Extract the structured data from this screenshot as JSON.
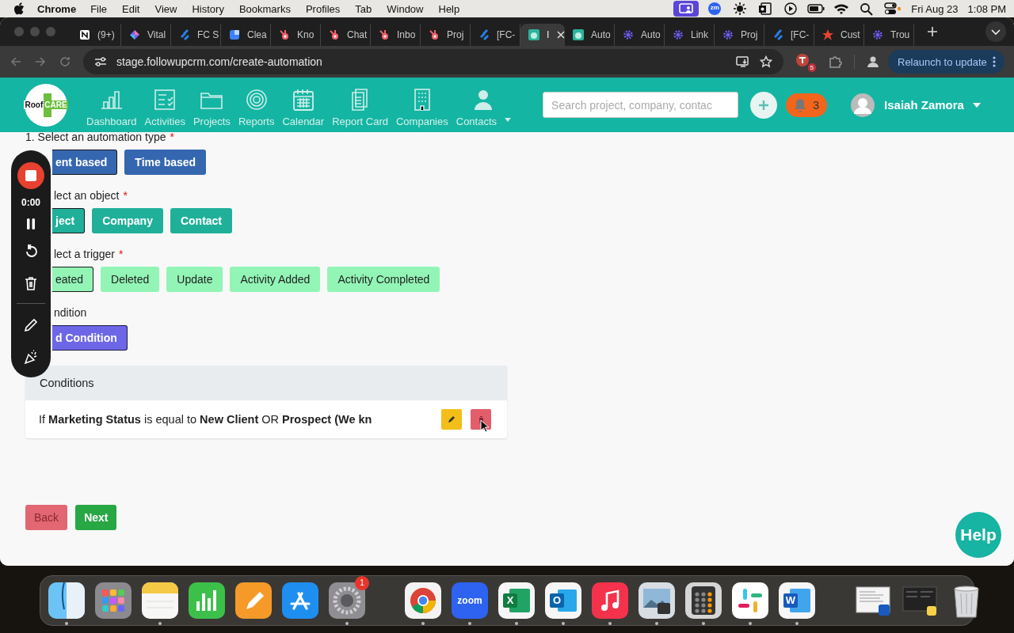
{
  "menubar": {
    "app": "Chrome",
    "menus": [
      "File",
      "Edit",
      "View",
      "History",
      "Bookmarks",
      "Profiles",
      "Tab",
      "Window",
      "Help"
    ],
    "status_icons": [
      {
        "kind": "screen-share",
        "active": true
      },
      {
        "kind": "zoom",
        "glyph": "zm",
        "active": false
      },
      {
        "kind": "brightness",
        "active": false
      },
      {
        "kind": "mail",
        "active": false
      },
      {
        "kind": "play",
        "active": false
      },
      {
        "kind": "battery",
        "active": false
      },
      {
        "kind": "wifi",
        "active": false
      },
      {
        "kind": "search",
        "active": false
      },
      {
        "kind": "control",
        "active": false
      }
    ],
    "date": "Fri Aug 23",
    "time": "1:08 PM"
  },
  "browser": {
    "tabs": [
      {
        "kind": "notion",
        "title": "(9+)",
        "selected": false
      },
      {
        "kind": "diamond",
        "title": "Vital",
        "selected": false
      },
      {
        "kind": "stripes",
        "title": "FC S",
        "selected": false
      },
      {
        "kind": "square",
        "title": "Clea",
        "selected": false
      },
      {
        "kind": "sprocket",
        "title": "Kno",
        "selected": false
      },
      {
        "kind": "sprocket",
        "title": "Chat",
        "selected": false
      },
      {
        "kind": "sprocket",
        "title": "Inbo",
        "selected": false
      },
      {
        "kind": "sprocket",
        "title": "Proj",
        "selected": false
      },
      {
        "kind": "stripes",
        "title": "[FC-",
        "selected": false
      },
      {
        "kind": "app",
        "title": "I",
        "selected": true
      },
      {
        "kind": "app",
        "title": "Auto",
        "selected": false
      },
      {
        "kind": "cog",
        "title": "Auto",
        "selected": false
      },
      {
        "kind": "cog",
        "title": "Link",
        "selected": false
      },
      {
        "kind": "cog",
        "title": "Proj",
        "selected": false
      },
      {
        "kind": "stripes",
        "title": "[FC-",
        "selected": false
      },
      {
        "kind": "star",
        "title": "Cust",
        "selected": false
      },
      {
        "kind": "cog",
        "title": "Trou",
        "selected": false
      }
    ],
    "url": "stage.followupcrm.com/create-automation",
    "extension_badge": "5",
    "relaunch": "Relaunch to update"
  },
  "app": {
    "logo": {
      "word_a": "Roof",
      "word_b": "CARE"
    },
    "nav": [
      {
        "label": "Dashboard",
        "kind": "chart",
        "has_menu": false
      },
      {
        "label": "Activities",
        "kind": "checklist",
        "has_menu": false
      },
      {
        "label": "Projects",
        "kind": "folder",
        "has_menu": false
      },
      {
        "label": "Reports",
        "kind": "target",
        "has_menu": false
      },
      {
        "label": "Calendar",
        "kind": "calendar",
        "has_menu": false
      },
      {
        "label": "Report Card",
        "kind": "docs",
        "has_menu": false
      },
      {
        "label": "Companies",
        "kind": "building",
        "has_menu": false
      },
      {
        "label": "Contacts",
        "kind": "person",
        "has_menu": true
      }
    ],
    "search": {
      "placeholder": "Search project, company, contac"
    },
    "notifications": "3",
    "user": "Isaiah Zamora"
  },
  "form": {
    "sections": [
      {
        "label": "1. Select an automation type",
        "required_mark": "*",
        "kind": "blue",
        "options": [
          {
            "label": "ent based",
            "selected": true
          },
          {
            "label": "Time based",
            "selected": false
          }
        ]
      },
      {
        "label": "lect an object",
        "required_mark": "*",
        "kind": "teal",
        "options": [
          {
            "label": "ject",
            "selected": true
          },
          {
            "label": "Company",
            "selected": false
          },
          {
            "label": "Contact",
            "selected": false
          }
        ]
      },
      {
        "label": "lect a trigger",
        "required_mark": "*",
        "kind": "mint",
        "options": [
          {
            "label": "eated",
            "selected": true
          },
          {
            "label": "Deleted",
            "selected": false
          },
          {
            "label": "Update",
            "selected": false
          },
          {
            "label": "Activity Added",
            "selected": false
          },
          {
            "label": "Activity Completed",
            "selected": false
          }
        ]
      },
      {
        "label": "ndition",
        "kind": "purple",
        "options": [
          {
            "label": "d Condition"
          }
        ]
      }
    ],
    "conditions": {
      "title": "Conditions",
      "rows": [
        {
          "text": "If **Marketing Status** is equal to **New Client** OR **Prospect (We kn**"
        }
      ]
    },
    "back": "Back",
    "next": "Next"
  },
  "recorder": {
    "time": "0:00"
  },
  "help": "Help",
  "dock": {
    "items": [
      {
        "kind": "finder",
        "running": true
      },
      {
        "kind": "launchpad",
        "running": false
      },
      {
        "kind": "notes",
        "running": true
      },
      {
        "kind": "numbers",
        "running": false
      },
      {
        "kind": "pages",
        "running": false
      },
      {
        "kind": "appstore",
        "running": false
      },
      {
        "kind": "settings",
        "running": true,
        "badge": "1"
      },
      {
        "kind": "divider"
      },
      {
        "kind": "chrome",
        "running": true
      },
      {
        "kind": "zoom",
        "running": true,
        "glyph": "zoom"
      },
      {
        "kind": "excel",
        "running": true,
        "glyph": "X"
      },
      {
        "kind": "outlook",
        "running": true,
        "glyph": "O"
      },
      {
        "kind": "music",
        "running": true
      },
      {
        "kind": "preview",
        "running": true
      },
      {
        "kind": "calculator",
        "running": true
      },
      {
        "kind": "slack",
        "running": true
      },
      {
        "kind": "word",
        "running": true,
        "glyph": "W"
      },
      {
        "kind": "divider"
      },
      {
        "kind": "window",
        "running": false
      },
      {
        "kind": "window-dark",
        "running": false
      },
      {
        "kind": "trash",
        "running": false
      }
    ]
  }
}
